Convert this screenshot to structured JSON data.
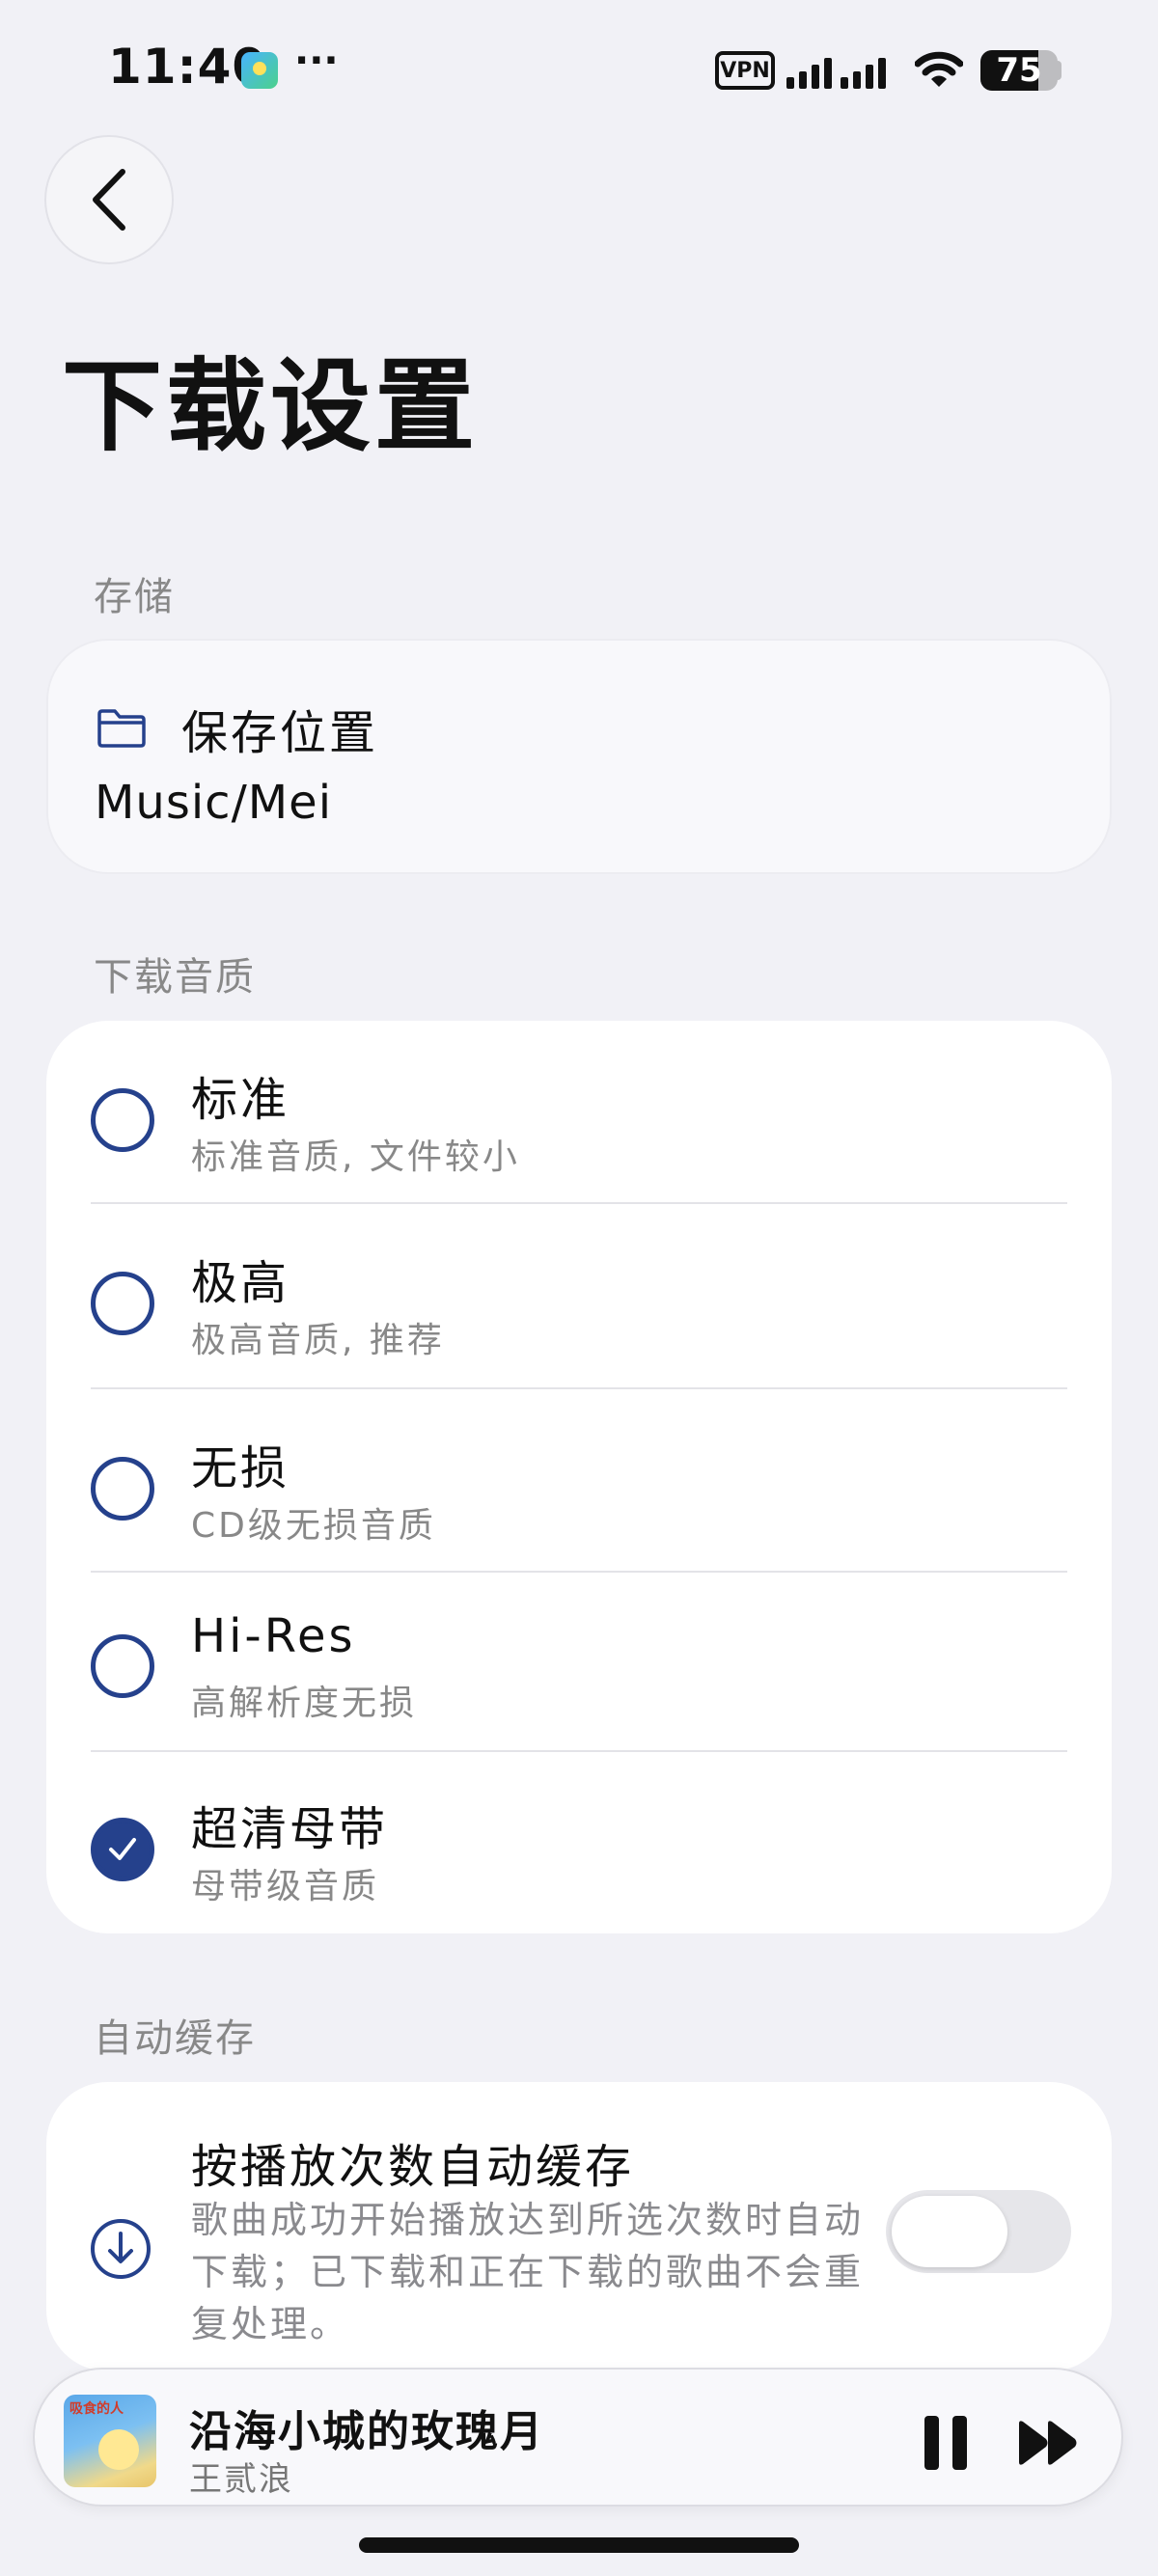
{
  "status_bar": {
    "time": "11:40",
    "more": "···",
    "vpn": "VPN",
    "battery": "75",
    "battery_level": 0.75
  },
  "page": {
    "title": "下载设置"
  },
  "storage": {
    "section_label": "存储",
    "title": "保存位置",
    "path": "Music/Mei"
  },
  "quality": {
    "section_label": "下载音质",
    "options": [
      {
        "title": "标准",
        "subtitle": "标准音质, 文件较小",
        "checked": false
      },
      {
        "title": "极高",
        "subtitle": "极高音质, 推荐",
        "checked": false
      },
      {
        "title": "无损",
        "subtitle": "CD级无损音质",
        "checked": false
      },
      {
        "title": "Hi-Res",
        "subtitle": "高解析度无损",
        "checked": false
      },
      {
        "title": "超清母带",
        "subtitle": "母带级音质",
        "checked": true
      }
    ]
  },
  "auto_cache": {
    "section_label": "自动缓存",
    "title": "按播放次数自动缓存",
    "description": "歌曲成功开始播放达到所选次数时自动下载；已下载和正在下载的歌曲不会重复处理。",
    "enabled": false
  },
  "player": {
    "cover_text": "吸食的人",
    "song": "沿海小城的玫瑰月",
    "artist": "王贰浪"
  },
  "colors": {
    "accent": "#25418c",
    "background": "#f1f1f6",
    "card": "#ffffff"
  }
}
